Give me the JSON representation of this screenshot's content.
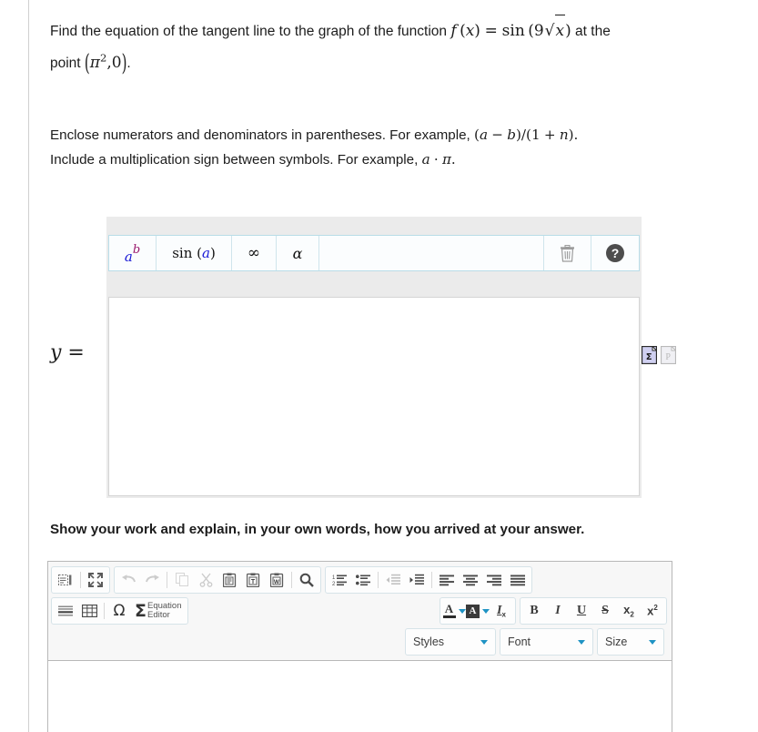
{
  "problem": {
    "line1_pre": "Find the equation of the tangent line to the graph of the function ",
    "fx": "f (x) = sin (9√x)",
    "line1_post": " at the",
    "line2_pre": "point ",
    "point": "(π², 0)",
    "line2_post": "."
  },
  "instructions": {
    "line1": "Enclose numerators and denominators in parentheses. For example, (a − b)/(1 + n).",
    "line2": "Include a multiplication sign between symbols. For example, a · π."
  },
  "math_widget": {
    "toolbar": {
      "power_label": "a^b",
      "power_base": "a",
      "power_exp": "b",
      "sin_prefix": "sin (",
      "sin_arg": "a",
      "sin_suffix": ")",
      "infinity_label": "∞",
      "alpha_label": "α",
      "trash_label": "trash",
      "help_label": "?"
    },
    "answer_prefix": "y =",
    "answer_value": ""
  },
  "side_icons": {
    "equation_preview": "Σ",
    "plain_preview": "P"
  },
  "work_section": {
    "heading": "Show your work and explain, in your own words, how you arrived at your answer."
  },
  "editor": {
    "row1_group1": [
      {
        "name": "show-blocks-icon",
        "glyph": "▤|"
      },
      {
        "name": "maximize-icon",
        "glyph": "⤢"
      }
    ],
    "row1_group2": [
      {
        "name": "undo-icon",
        "glyph": "↶",
        "disabled": true
      },
      {
        "name": "redo-icon",
        "glyph": "↷",
        "disabled": true
      },
      {
        "name": "copy-icon",
        "glyph": "⧉",
        "disabled": true
      },
      {
        "name": "cut-icon",
        "glyph": "✂",
        "disabled": true
      },
      {
        "name": "paste-icon",
        "glyph": "📋",
        "disabled": false
      },
      {
        "name": "paste-text-icon",
        "glyph": "T",
        "disabled": false
      },
      {
        "name": "paste-word-icon",
        "glyph": "W",
        "disabled": false
      },
      {
        "name": "find-icon",
        "glyph": "🔍",
        "disabled": false
      }
    ],
    "row1_group3": [
      {
        "name": "numbered-list-icon",
        "glyph": "1.",
        "disabled": false
      },
      {
        "name": "bulleted-list-icon",
        "glyph": "•",
        "disabled": false
      },
      {
        "name": "outdent-icon",
        "glyph": "⇤",
        "disabled": true
      },
      {
        "name": "indent-icon",
        "glyph": "⇥",
        "disabled": false
      },
      {
        "name": "align-left-icon",
        "glyph": "≡",
        "disabled": false
      },
      {
        "name": "align-center-icon",
        "glyph": "≡",
        "disabled": false
      },
      {
        "name": "align-right-icon",
        "glyph": "≡",
        "disabled": false
      },
      {
        "name": "align-justify-icon",
        "glyph": "≡",
        "disabled": false
      }
    ],
    "row2_group1": [
      {
        "name": "horizontal-rule-icon",
        "glyph": "▬"
      },
      {
        "name": "table-icon",
        "glyph": "▦"
      },
      {
        "name": "special-char-icon",
        "glyph": "Ω"
      }
    ],
    "equation_editor": {
      "sigma": "Σ",
      "label_line1": "Equation",
      "label_line2": "Editor"
    },
    "row2_group2": [
      {
        "name": "text-color-icon",
        "glyph": "A"
      },
      {
        "name": "background-color-icon",
        "glyph": "A"
      },
      {
        "name": "remove-format-icon",
        "glyph": "Ix"
      }
    ],
    "row2_group3": [
      {
        "name": "bold-icon",
        "glyph": "B"
      },
      {
        "name": "italic-icon",
        "glyph": "I"
      },
      {
        "name": "underline-icon",
        "glyph": "U"
      },
      {
        "name": "strikethrough-icon",
        "glyph": "S"
      },
      {
        "name": "subscript-icon",
        "glyph": "x₂"
      },
      {
        "name": "superscript-icon",
        "glyph": "x²"
      }
    ],
    "combos": {
      "styles": "Styles",
      "font": "Font",
      "size": "Size"
    },
    "body_value": ""
  },
  "colors": {
    "accent_blue": "#1f93c4",
    "toolbar_border": "#b9dde8",
    "widget_bg": "#ebebeb",
    "text": "#1c1c1c",
    "exponent_magenta": "#9b1b6e",
    "variable_blue": "#1a1ad6"
  }
}
